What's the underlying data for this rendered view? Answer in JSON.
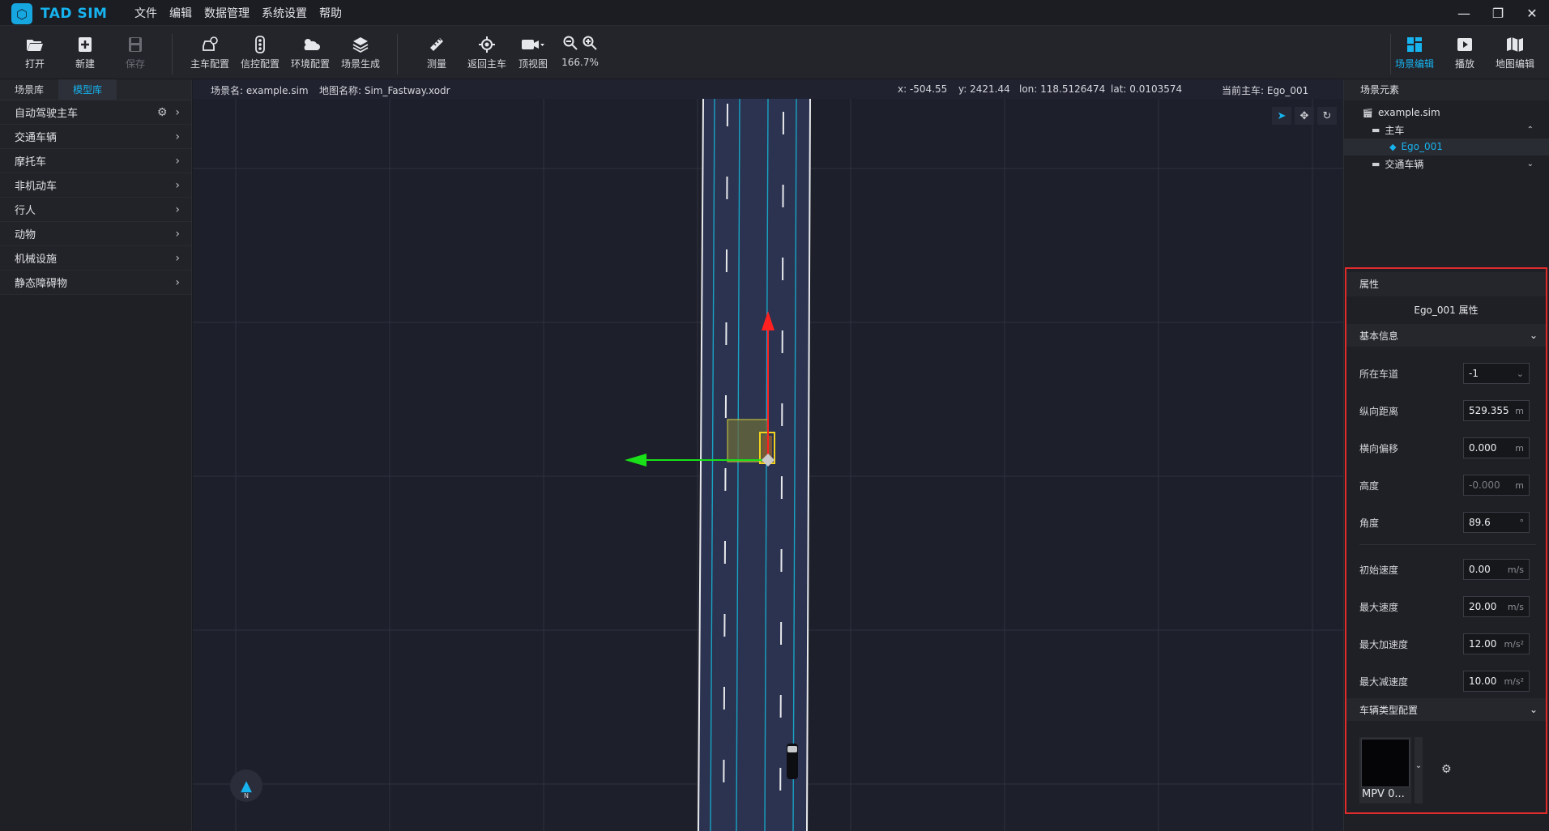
{
  "app": {
    "name": "TAD SIM",
    "logo_icon": "hexagon-logo-icon"
  },
  "menu": [
    "文件",
    "编辑",
    "数据管理",
    "系统设置",
    "帮助"
  ],
  "window_controls": {
    "minimize": "—",
    "restore": "❐",
    "close": "✕"
  },
  "toolbar": {
    "open": {
      "label": "打开",
      "icon": "folder-open-icon"
    },
    "new": {
      "label": "新建",
      "icon": "new-file-icon"
    },
    "save": {
      "label": "保存",
      "icon": "save-icon",
      "disabled": true
    },
    "ego_config": {
      "label": "主车配置",
      "icon": "car-settings-icon"
    },
    "signal_config": {
      "label": "信控配置",
      "icon": "traffic-light-icon"
    },
    "env_config": {
      "label": "环境配置",
      "icon": "weather-icon"
    },
    "scene_gen": {
      "label": "场景生成",
      "icon": "layers-icon"
    },
    "measure": {
      "label": "测量",
      "icon": "ruler-icon"
    },
    "return_ego": {
      "label": "返回主车",
      "icon": "target-icon"
    },
    "top_view": {
      "label": "顶视图",
      "icon": "camera-icon"
    },
    "zoom": {
      "label": "166.7%",
      "out_icon": "zoom-out-icon",
      "in_icon": "zoom-in-icon"
    },
    "scene_edit": {
      "label": "场景编辑",
      "icon": "grid-icon",
      "active": true
    },
    "play": {
      "label": "播放",
      "icon": "play-icon"
    },
    "map_edit": {
      "label": "地图编辑",
      "icon": "map-icon"
    }
  },
  "left_panel": {
    "tabs": [
      {
        "label": "场景库",
        "active": false
      },
      {
        "label": "模型库",
        "active": true
      }
    ],
    "categories": [
      "自动驾驶主车",
      "交通车辆",
      "摩托车",
      "非机动车",
      "行人",
      "动物",
      "机械设施",
      "静态障碍物"
    ]
  },
  "info_bar": {
    "scene_name": "场景名: example.sim",
    "map_name": "地图名称: Sim_Fastway.xodr",
    "x": "x: -504.55",
    "y": "y: 2421.44",
    "lon": "lon: 118.5126474",
    "lat": "lat: 0.0103574",
    "current_ego": "当前主车: Ego_001"
  },
  "compass": {
    "label": "N"
  },
  "scene_tree": {
    "title": "场景元素",
    "file": "example.sim",
    "group_ego": "主车",
    "ego_item": "Ego_001",
    "group_traffic": "交通车辆"
  },
  "properties": {
    "header": "属性",
    "title": "Ego_001 属性",
    "section_basic": "基本信息",
    "lane": {
      "label": "所在车道",
      "value": "-1"
    },
    "longitudinal": {
      "label": "纵向距离",
      "value": "529.355",
      "unit": "m"
    },
    "lateral": {
      "label": "横向偏移",
      "value": "0.000",
      "unit": "m"
    },
    "height": {
      "label": "高度",
      "value": "-0.000",
      "unit": "m"
    },
    "angle": {
      "label": "角度",
      "value": "89.6",
      "unit": "°"
    },
    "init_speed": {
      "label": "初始速度",
      "value": "0.00",
      "unit": "m/s"
    },
    "max_speed": {
      "label": "最大速度",
      "value": "20.00",
      "unit": "m/s"
    },
    "max_accel": {
      "label": "最大加速度",
      "value": "12.00",
      "unit": "m/s²"
    },
    "max_decel": {
      "label": "最大减速度",
      "value": "10.00",
      "unit": "m/s²"
    },
    "section_vehicle": "车辆类型配置",
    "vehicle_type": "MPV 0..."
  },
  "colors": {
    "accent": "#17b3ef",
    "highlight_border": "#e02b2b",
    "road": "#2b3350",
    "lane_line": "#19a3c4"
  }
}
